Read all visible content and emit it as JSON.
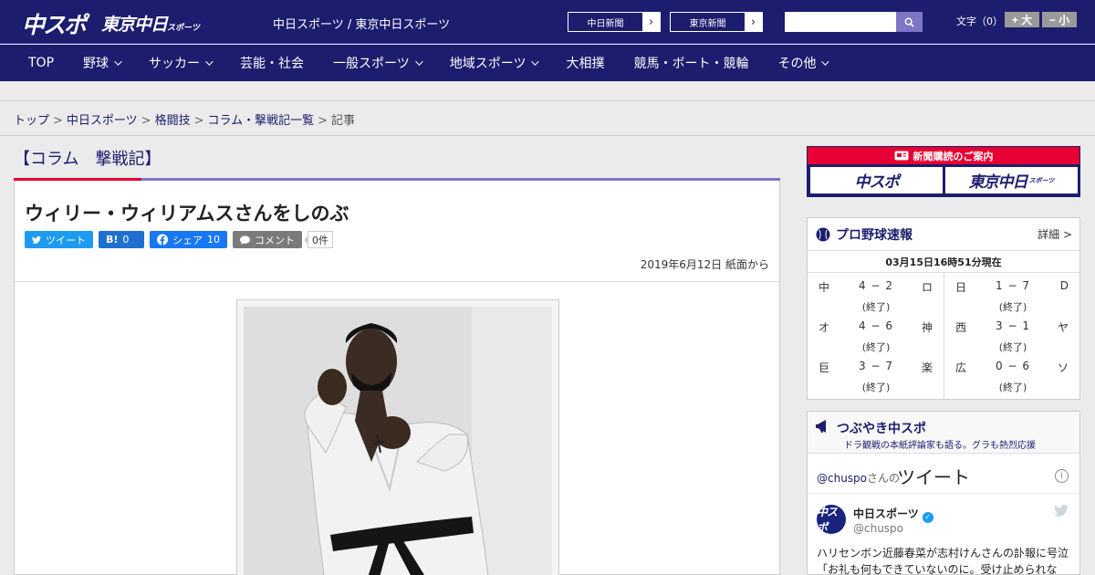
{
  "header": {
    "logo_main": "中スポ",
    "logo_sub": "東京中日",
    "logo_sub_small": "スポーツ",
    "site_name": "中日スポーツ / 東京中日スポーツ",
    "paper_links": [
      {
        "label": "中日新聞",
        "icon": "chevron-right-icon"
      },
      {
        "label": "東京新聞",
        "icon": "chevron-right-icon"
      }
    ],
    "search": {
      "value": "",
      "placeholder": "",
      "icon": "search-icon"
    },
    "font_size_label": "文字（0）",
    "font_larger": "+ 大",
    "font_smaller": "− 小"
  },
  "nav": [
    {
      "label": "TOP",
      "dropdown": false
    },
    {
      "label": "野球",
      "dropdown": true
    },
    {
      "label": "サッカー",
      "dropdown": true
    },
    {
      "label": "芸能・社会",
      "dropdown": false
    },
    {
      "label": "一般スポーツ",
      "dropdown": true
    },
    {
      "label": "地域スポーツ",
      "dropdown": true
    },
    {
      "label": "大相撲",
      "dropdown": false
    },
    {
      "label": "競馬・ボート・競輪",
      "dropdown": false
    },
    {
      "label": "その他",
      "dropdown": true
    }
  ],
  "breadcrumb": [
    "トップ",
    "中日スポーツ",
    "格闘技",
    "コラム・撃戦記一覧",
    "記事"
  ],
  "section_title": "【コラム　撃戦記】",
  "article": {
    "title": "ウィリー・ウィリアムスさんをしのぶ",
    "share": {
      "tweet": "ツイート",
      "hatena_label": "B!",
      "hatena_count": "0",
      "facebook": "シェア",
      "facebook_count": "10",
      "comment": "コメント",
      "comment_count": "0件"
    },
    "date": "2019年6月12日 紙面から"
  },
  "sidebar": {
    "promo": {
      "heading": "新聞購読のご案内",
      "btn1": "中スポ",
      "btn2": "東京中日",
      "btn2_small": "スポーツ"
    },
    "baseball": {
      "title": "プロ野球速報",
      "detail": "詳細 >",
      "time": "03月15日16時51分現在",
      "left": [
        {
          "home": "中",
          "score": "4 − 2",
          "away": "ロ",
          "status": "(終了)"
        },
        {
          "home": "オ",
          "score": "4 − 6",
          "away": "神",
          "status": "(終了)"
        },
        {
          "home": "巨",
          "score": "3 − 7",
          "away": "楽",
          "status": "(終了)"
        }
      ],
      "right": [
        {
          "home": "日",
          "score": "1 − 7",
          "away": "D",
          "status": "(終了)"
        },
        {
          "home": "西",
          "score": "3 − 1",
          "away": "ヤ",
          "status": "(終了)"
        },
        {
          "home": "広",
          "score": "0 − 6",
          "away": "ソ",
          "status": "(終了)"
        }
      ]
    },
    "tweets": {
      "title": "つぶやき中スポ",
      "subtitle": "ドラ観戦の本紙評論家も語る。グラも熱烈応援",
      "handle_link": "@chuspo",
      "handle_suffix": "さんの",
      "heading_big": "ツイート",
      "info": "i",
      "tweet": {
        "avatar_text": "中スポ",
        "name": "中日スポーツ",
        "username": "@chuspo",
        "text": "ハリセンボン近藤春菜が志村けんさんの訃報に号泣「お礼も何もできていないのに。受け止められな"
      }
    }
  }
}
